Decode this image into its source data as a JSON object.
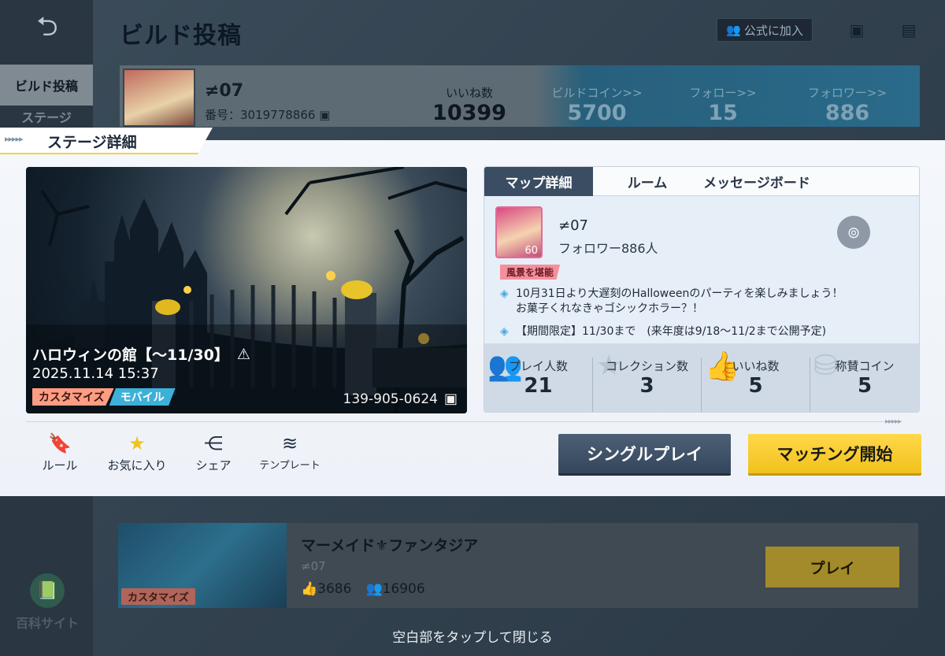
{
  "header": {
    "page_title": "ビルド投稿",
    "join_official_label": "公式に加入",
    "back_icon": "back-arrow-icon",
    "copy_icon": "copy-icon",
    "chat_icon": "chat-icon"
  },
  "sidebar": {
    "items": [
      {
        "label": "ビルド投稿"
      },
      {
        "label": "ステージ"
      }
    ],
    "wiki_label": "百科サイト"
  },
  "profile": {
    "name": "≠07",
    "id_label": "番号：3019778866",
    "likes_label": "いいね数",
    "likes_value": "10399",
    "coins_label": "ビルドコイン>>",
    "coins_value": "5700",
    "follow_label": "フォロー>>",
    "follow_value": "15",
    "followers_label": "フォロワー>>",
    "followers_value": "886"
  },
  "modal": {
    "title": "ステージ詳細",
    "stage": {
      "title": "ハロウィンの館【～11/30】",
      "warning_icon": "warning-icon",
      "date": "2025.11.14 15:37",
      "tags": [
        "カスタマイズ",
        "モバイル"
      ],
      "code": "139-905-0624"
    },
    "tabs": [
      "マップ詳細",
      "ルーム",
      "メッセージボード"
    ],
    "author": {
      "name": "≠07",
      "followers": "フォロワー886人",
      "level": "60",
      "badge": "風景を堪能"
    },
    "descriptions": [
      "10月31日より大遅刻のHalloweenのパーティを楽しみましょう！お菓子くれなきゃゴシックホラー？！",
      "【期間限定】11/30まで　(来年度は9/18～11/2まで公開予定)"
    ],
    "stats": [
      {
        "label": "プレイ人数",
        "value": "21",
        "icon": "players-icon"
      },
      {
        "label": "コレクション数",
        "value": "3",
        "icon": "star-icon"
      },
      {
        "label": "いいね数",
        "value": "5",
        "icon": "thumbs-up-icon"
      },
      {
        "label": "称賛コイン",
        "value": "5",
        "icon": "coin-stack-icon"
      }
    ],
    "actions": [
      {
        "label": "ルール",
        "icon": "rule-book-icon"
      },
      {
        "label": "お気に入り",
        "icon": "star-icon"
      },
      {
        "label": "シェア",
        "icon": "share-icon"
      },
      {
        "label": "テンプレート",
        "icon": "layers-icon"
      }
    ],
    "single_play_label": "シングルプレイ",
    "matching_label": "マッチング開始"
  },
  "next_card": {
    "title": "マーメイド⚜ファンタジア",
    "author": "≠07",
    "tag": "カスタマイズ",
    "likes": "3686",
    "players": "16906",
    "play_label": "プレイ"
  },
  "close_hint": "空白部をタップして閉じる",
  "colors": {
    "accent_yellow": "#f1c21d",
    "dark_button": "#3b4d62",
    "tag_custom": "#ff9d84",
    "tag_mobile": "#3db0d8"
  }
}
